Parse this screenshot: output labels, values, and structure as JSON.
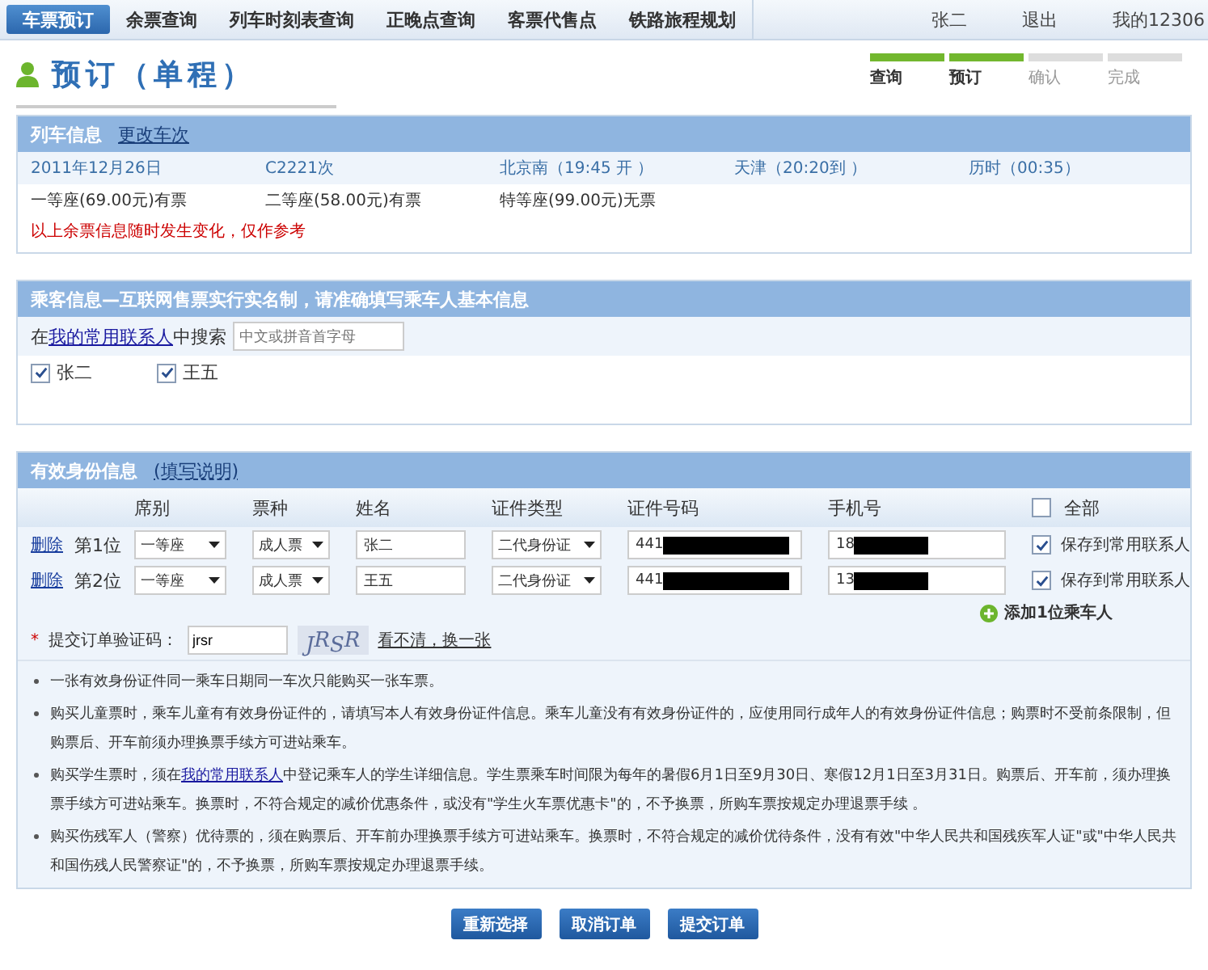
{
  "nav": {
    "tabs": [
      {
        "label": "车票预订",
        "selected": true
      },
      {
        "label": "余票查询",
        "selected": false
      },
      {
        "label": "列车时刻表查询",
        "selected": false
      },
      {
        "label": "正晚点查询",
        "selected": false
      },
      {
        "label": "客票代售点",
        "selected": false
      },
      {
        "label": "铁路旅程规划",
        "selected": false
      }
    ],
    "user": "张二",
    "logout": "退出",
    "account": "我的12306"
  },
  "page_title": "预订（单程）",
  "steps": [
    {
      "label": "查询",
      "done": true
    },
    {
      "label": "预订",
      "done": true
    },
    {
      "label": "确认",
      "done": false
    },
    {
      "label": "完成",
      "done": false
    }
  ],
  "train_info": {
    "title": "列车信息",
    "change_link": "更改车次",
    "summary": [
      "2011年12月26日",
      "C2221次",
      "北京南（19:45 开 ）",
      "天津（20:20到 ）",
      "历时（00:35）"
    ],
    "seats": [
      "一等座(69.00元)有票",
      "二等座(58.00元)有票",
      "特等座(99.00元)无票"
    ],
    "notice": "以上余票信息随时发生变化，仅作参考"
  },
  "passenger_info": {
    "title": "乘客信息—互联网售票实行实名制，请准确填写乘车人基本信息",
    "search_prefix": "在",
    "search_link": "我的常用联系人",
    "search_suffix": "中搜索",
    "search_placeholder": "中文或拼音首字母",
    "contacts": [
      {
        "name": "张二",
        "checked": true
      },
      {
        "name": "王五",
        "checked": true
      }
    ]
  },
  "id_info": {
    "title": "有效身份信息",
    "help_link": "(填写说明)",
    "columns": [
      "席别",
      "票种",
      "姓名",
      "证件类型",
      "证件号码",
      "手机号"
    ],
    "select_all": {
      "label": "全部",
      "checked": false
    },
    "rows": [
      {
        "delete": "删除",
        "position": "第1位",
        "seat": "一等座",
        "ticket": "成人票",
        "name": "张二",
        "id_type": "二代身份证",
        "id_number": "441",
        "id_redacted": true,
        "phone": "18",
        "phone_redacted": true,
        "save": {
          "label": "保存到常用联系人",
          "checked": true
        }
      },
      {
        "delete": "删除",
        "position": "第2位",
        "seat": "一等座",
        "ticket": "成人票",
        "name": "王五",
        "id_type": "二代身份证",
        "id_number": "441",
        "id_redacted": true,
        "phone": "13",
        "phone_redacted": true,
        "save": {
          "label": "保存到常用联系人",
          "checked": true
        }
      }
    ],
    "add_passenger": "添加1位乘车人",
    "captcha": {
      "required_mark": "*",
      "label": "提交订单验证码：",
      "value": "jrsr",
      "image_text": "JRSR",
      "refresh_link": "看不清，换一张"
    },
    "notes": [
      {
        "text": "一张有效身份证件同一乘车日期同一车次只能购买一张车票。"
      },
      {
        "text": "购买儿童票时，乘车儿童有有效身份证件的，请填写本人有效身份证件信息。乘车儿童没有有效身份证件的，应使用同行成年人的有效身份证件信息；购票时不受前条限制，但购票后、开车前须办理换票手续方可进站乘车。"
      },
      {
        "text": "购买学生票时，须在",
        "link": "我的常用联系人",
        "text_after": "中登记乘车人的学生详细信息。学生票乘车时间限为每年的暑假6月1日至9月30日、寒假12月1日至3月31日。购票后、开车前，须办理换票手续方可进站乘车。换票时，不符合规定的减价优惠条件，或没有\"学生火车票优惠卡\"的，不予换票，所购车票按规定办理退票手续 。"
      },
      {
        "text": "购买伤残军人（警察）优待票的，须在购票后、开车前办理换票手续方可进站乘车。换票时，不符合规定的减价优待条件，没有有效\"中华人民共和国残疾军人证\"或\"中华人民共和国伤残人民警察证\"的，不予换票，所购车票按规定办理退票手续。"
      }
    ]
  },
  "buttons": [
    "重新选择",
    "取消订单",
    "提交订单"
  ]
}
